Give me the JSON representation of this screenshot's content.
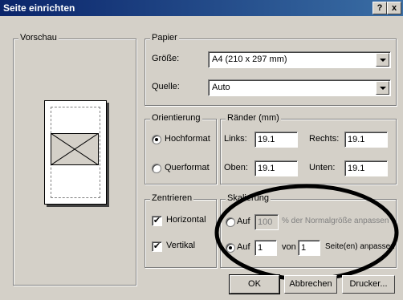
{
  "window": {
    "title": "Seite einrichten",
    "help_btn": "?",
    "close_btn": "x"
  },
  "preview": {
    "label": "Vorschau"
  },
  "paper": {
    "label": "Papier",
    "size_label": "Größe:",
    "size_value": "A4 (210 x 297 mm)",
    "source_label": "Quelle:",
    "source_value": "Auto"
  },
  "orientation": {
    "label": "Orientierung",
    "portrait": "Hochformat",
    "landscape": "Querformat"
  },
  "margins": {
    "label": "Ränder (mm)",
    "left_label": "Links:",
    "left_value": "19.1",
    "right_label": "Rechts:",
    "right_value": "19.1",
    "top_label": "Oben:",
    "top_value": "19.1",
    "bottom_label": "Unten:",
    "bottom_value": "19.1"
  },
  "center": {
    "label": "Zentrieren",
    "horizontal": "Horizontal",
    "vertical": "Vertikal"
  },
  "scaling": {
    "label": "Skalierung",
    "fit_label": "Auf",
    "fit_value": "100",
    "fit_suffix": "% der Normalgröße anpassen",
    "pages_label": "Auf",
    "pages_wide": "1",
    "pages_of": "von",
    "pages_tall": "1",
    "pages_suffix": "Seite(en) anpassen"
  },
  "buttons": {
    "ok": "OK",
    "cancel": "Abbrechen",
    "printer": "Drucker..."
  }
}
